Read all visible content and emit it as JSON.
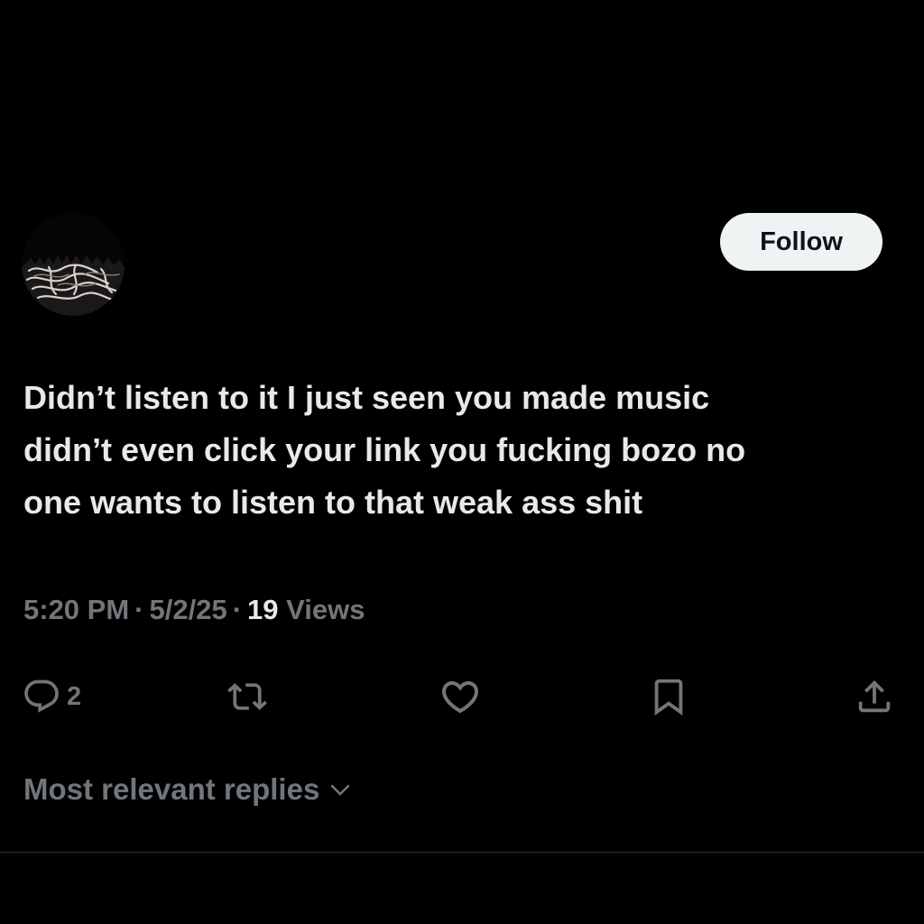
{
  "header": {
    "follow_label": "Follow"
  },
  "post": {
    "text_lines": [
      "Didn’t listen to it I just seen you made music",
      "didn’t even click your link you fucking bozo no",
      "one wants to listen to that weak ass shit"
    ],
    "time": "5:20 PM",
    "date": "5/2/25",
    "separator": "·",
    "views_count": "19",
    "views_label": "Views"
  },
  "actions": {
    "reply_count": "2",
    "icons": [
      "reply-icon",
      "repost-icon",
      "like-icon",
      "bookmark-icon",
      "share-icon"
    ]
  },
  "replies": {
    "sort_label": "Most relevant replies"
  },
  "colors": {
    "background": "#000000",
    "text_primary": "#e7e9ea",
    "text_secondary": "#71767b",
    "follow_bg": "#eff3f4",
    "follow_text": "#0f1419",
    "divider": "#2f3336"
  }
}
